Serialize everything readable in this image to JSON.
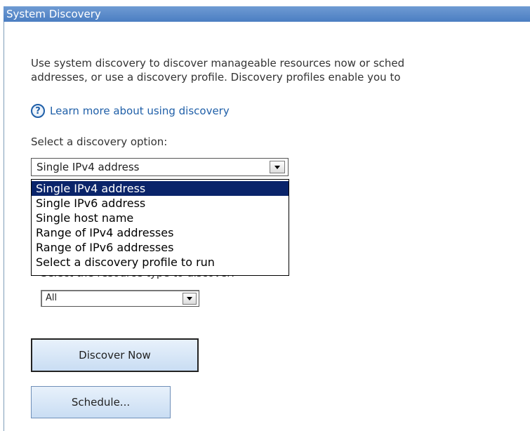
{
  "window": {
    "title": "System Discovery"
  },
  "description": {
    "line1": "Use system discovery to discover manageable resources now or sched",
    "line2": "addresses, or use a discovery profile. Discovery profiles enable you to"
  },
  "help": {
    "icon": "question-circle-icon",
    "link_text": "Learn more about using discovery"
  },
  "discovery_option": {
    "label": "Select a discovery option:",
    "selected": "Single IPv4 address",
    "options": [
      "Single IPv4 address",
      "Single IPv6 address",
      "Single host name",
      "Range of IPv4 addresses",
      "Range of IPv6 addresses",
      "Select a discovery profile to run"
    ]
  },
  "resource_type": {
    "label": "Select the resource type to discover:",
    "selected": "All"
  },
  "buttons": {
    "discover_now": "Discover Now",
    "schedule": "Schedule..."
  },
  "colors": {
    "title_bar": "#5a8acb",
    "link": "#1f5fa8",
    "selected_option": "#0a246a",
    "button": "#d6e6f7"
  }
}
